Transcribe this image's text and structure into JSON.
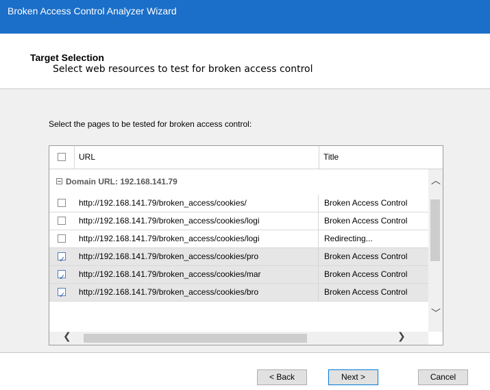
{
  "window": {
    "title": "Broken Access Control Analyzer Wizard"
  },
  "header": {
    "title": "Target Selection",
    "subtitle": "Select web resources to test for broken access control"
  },
  "content": {
    "instruction": "Select the pages to be tested for broken access control:",
    "grid": {
      "columns": {
        "url": "URL",
        "title": "Title"
      },
      "header_checkbox_checked": false,
      "group": {
        "label": "Domain URL: 192.168.141.79",
        "expanded": true
      },
      "rows": [
        {
          "checked": false,
          "url": "http://192.168.141.79/broken_access/cookies/",
          "title": "Broken Access Control"
        },
        {
          "checked": false,
          "url": "http://192.168.141.79/broken_access/cookies/logi",
          "title": "Broken Access Control"
        },
        {
          "checked": false,
          "url": "http://192.168.141.79/broken_access/cookies/logi",
          "title": "Redirecting..."
        },
        {
          "checked": true,
          "url": "http://192.168.141.79/broken_access/cookies/pro",
          "title": "Broken Access Control"
        },
        {
          "checked": true,
          "url": "http://192.168.141.79/broken_access/cookies/mar",
          "title": "Broken Access Control"
        },
        {
          "checked": true,
          "url": "http://192.168.141.79/broken_access/cookies/bro",
          "title": "Broken Access Control"
        }
      ]
    }
  },
  "footer": {
    "back_label": "< Back",
    "next_label": "Next >",
    "cancel_label": "Cancel"
  },
  "icons": {
    "scroll_up": "chevron-up-icon",
    "scroll_down": "chevron-down-icon",
    "scroll_left": "chevron-left-icon",
    "scroll_right": "chevron-right-icon"
  },
  "colors": {
    "titlebar": "#1b6fc8",
    "selected_row": "#e6e6e6"
  }
}
